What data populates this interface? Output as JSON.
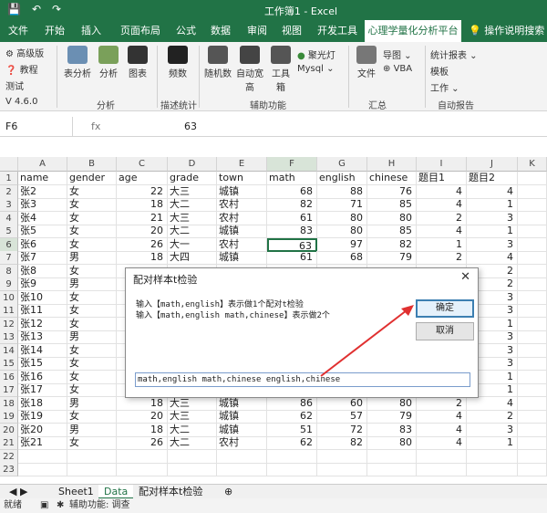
{
  "window": {
    "title": "工作簿1 - Excel",
    "qat": [
      "💾",
      "↶",
      "↷"
    ]
  },
  "tabs": [
    "文件",
    "开始",
    "插入",
    "页面布局",
    "公式",
    "数据",
    "审阅",
    "视图",
    "开发工具",
    "心理学量化分析平台",
    "操作说明搜索"
  ],
  "ribbon": {
    "left_items": [
      "高级版",
      "教程",
      "测试"
    ],
    "version": "V 4.6.0",
    "analysis_items": [
      "表分析",
      "分析",
      "图表"
    ],
    "freq": "频数",
    "random": "随机数",
    "auto_width": "自动宽高",
    "tools": "工具箱",
    "spotlight": "聚光灯",
    "mysql": "Mysql",
    "file": "文件",
    "import": "导图",
    "vba": "VBA",
    "stat_report": "统计报表",
    "template": "模板",
    "work": "工作",
    "groups": [
      "分析",
      "描述统计",
      "辅助功能",
      "汇总",
      "自动报告"
    ]
  },
  "formula_bar": {
    "cell_ref": "F6",
    "fx": "fx",
    "value": "63"
  },
  "columns": [
    "A",
    "B",
    "C",
    "D",
    "E",
    "F",
    "G",
    "H",
    "I",
    "J",
    "K"
  ],
  "rows": [
    [
      "name",
      "gender",
      "age",
      "grade",
      "town",
      "math",
      "english",
      "chinese",
      "题目1",
      "题目2"
    ],
    [
      "张2",
      "女",
      "22",
      "大三",
      "城镇",
      "68",
      "88",
      "76",
      "4",
      "4"
    ],
    [
      "张3",
      "女",
      "18",
      "大二",
      "农村",
      "82",
      "71",
      "85",
      "4",
      "1"
    ],
    [
      "张4",
      "女",
      "21",
      "大三",
      "农村",
      "61",
      "80",
      "80",
      "2",
      "3"
    ],
    [
      "张5",
      "女",
      "20",
      "大二",
      "城镇",
      "83",
      "80",
      "85",
      "4",
      "1"
    ],
    [
      "张6",
      "女",
      "26",
      "大一",
      "农村",
      "63",
      "97",
      "82",
      "1",
      "3"
    ],
    [
      "张7",
      "男",
      "18",
      "大四",
      "城镇",
      "61",
      "68",
      "79",
      "2",
      "4"
    ],
    [
      "张8",
      "女",
      "",
      "",
      "",
      "",
      "",
      "",
      "",
      "2"
    ],
    [
      "张9",
      "男",
      "",
      "",
      "",
      "",
      "",
      "",
      "",
      "2"
    ],
    [
      "张10",
      "女",
      "",
      "",
      "",
      "",
      "",
      "",
      "",
      "3"
    ],
    [
      "张11",
      "女",
      "",
      "",
      "",
      "",
      "",
      "",
      "",
      "3"
    ],
    [
      "张12",
      "女",
      "",
      "",
      "",
      "",
      "",
      "",
      "",
      "1"
    ],
    [
      "张13",
      "男",
      "",
      "",
      "",
      "",
      "",
      "",
      "",
      "3"
    ],
    [
      "张14",
      "女",
      "",
      "",
      "",
      "",
      "",
      "",
      "",
      "3"
    ],
    [
      "张15",
      "女",
      "",
      "",
      "",
      "",
      "",
      "",
      "",
      "3"
    ],
    [
      "张16",
      "女",
      "",
      "",
      "",
      "",
      "",
      "",
      "",
      "1"
    ],
    [
      "张17",
      "女",
      "",
      "",
      "",
      "",
      "",
      "",
      "",
      "1"
    ],
    [
      "张18",
      "男",
      "18",
      "大三",
      "城镇",
      "86",
      "60",
      "80",
      "2",
      "4"
    ],
    [
      "张19",
      "女",
      "20",
      "大三",
      "城镇",
      "62",
      "57",
      "79",
      "4",
      "2"
    ],
    [
      "张20",
      "男",
      "18",
      "大二",
      "城镇",
      "51",
      "72",
      "83",
      "4",
      "3"
    ],
    [
      "张21",
      "女",
      "26",
      "大二",
      "农村",
      "62",
      "82",
      "80",
      "4",
      "1"
    ],
    [
      "",
      "",
      "",
      "",
      "",
      "",
      "",
      "",
      "",
      ""
    ],
    [
      "",
      "",
      "",
      "",
      "",
      "",
      "",
      "",
      "",
      ""
    ]
  ],
  "sheet_tabs": [
    "Sheet1",
    "Data",
    "配对样本t检验"
  ],
  "status": [
    "就绪",
    "辅助功能: 调查"
  ],
  "dialog": {
    "title": "配对样本t检验",
    "line1": "输入【math,english】表示做1个配对t检验",
    "line2": "输入【math,english  math,chinese】表示做2个",
    "ok": "确定",
    "cancel": "取消",
    "input_value": "math,english math,chinese english,chinese"
  }
}
